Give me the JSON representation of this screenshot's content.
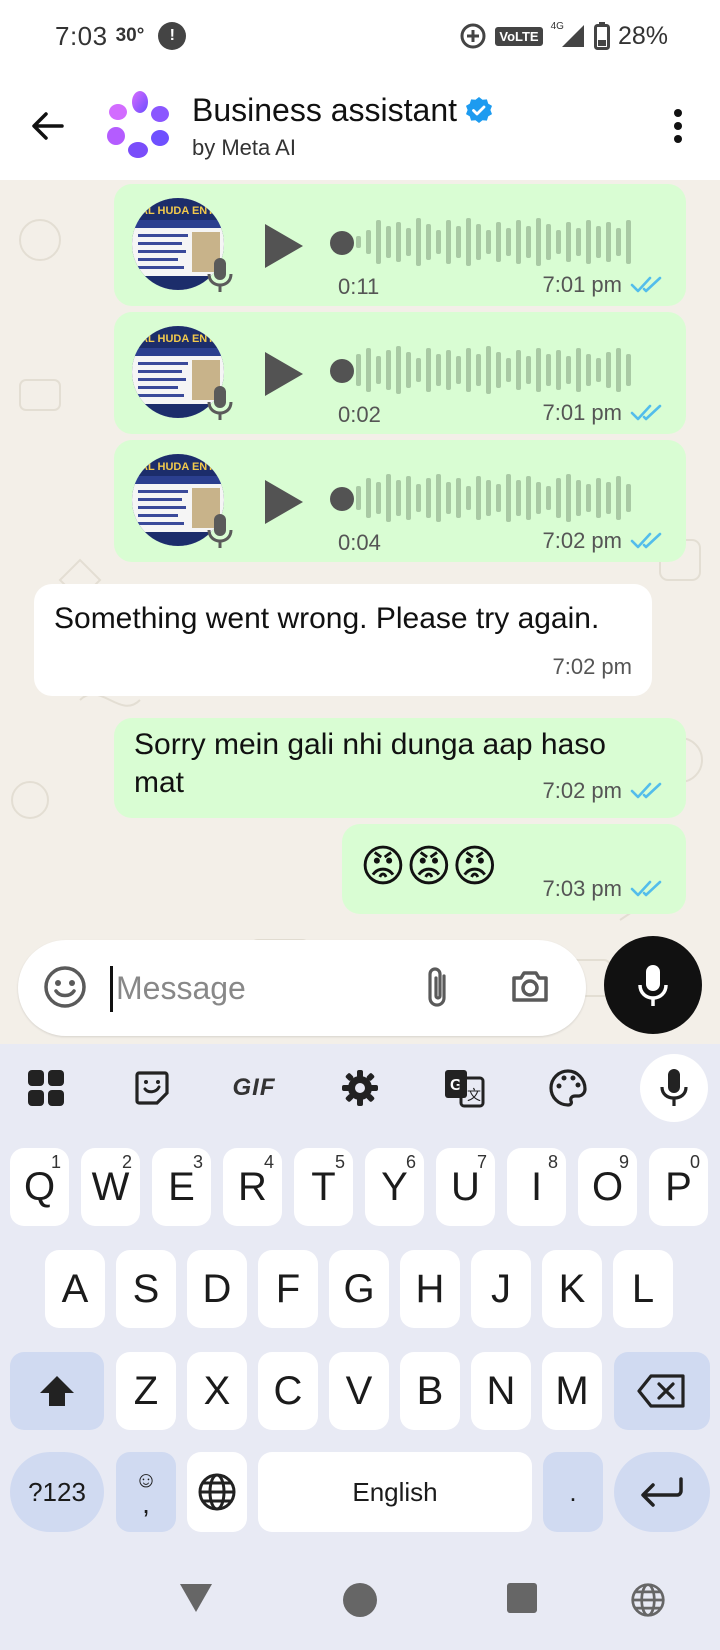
{
  "status_bar": {
    "time": "7:03",
    "temperature": "30°",
    "alert_icon": "!",
    "network": "4G",
    "volte": "VoLTE",
    "battery": "28%"
  },
  "header": {
    "title": "Business assistant",
    "subtitle": "by Meta AI",
    "verified_icon": "verified-badge-icon"
  },
  "messages": [
    {
      "type": "voice",
      "direction": "out",
      "duration": "0:11",
      "time": "7:01 pm",
      "status": "read"
    },
    {
      "type": "voice",
      "direction": "out",
      "duration": "0:02",
      "time": "7:01 pm",
      "status": "read"
    },
    {
      "type": "voice",
      "direction": "out",
      "duration": "0:04",
      "time": "7:02 pm",
      "status": "read"
    },
    {
      "type": "text",
      "direction": "in",
      "text": "Something went wrong. Please try again.",
      "time": "7:02 pm"
    },
    {
      "type": "text",
      "direction": "out",
      "text": "Sorry mein gali nhi dunga aap haso mat",
      "time": "7:02 pm",
      "status": "read"
    },
    {
      "type": "emoji",
      "direction": "out",
      "text": "😡😡😡",
      "time": "7:03 pm",
      "status": "read"
    }
  ],
  "voice_thumb": {
    "brand": "AL HUDA ENT",
    "line1": "Mehboob Nashimah Bijapur"
  },
  "composer": {
    "placeholder": "Message"
  },
  "keyboard": {
    "row1": [
      {
        "key": "Q",
        "hint": "1"
      },
      {
        "key": "W",
        "hint": "2"
      },
      {
        "key": "E",
        "hint": "3"
      },
      {
        "key": "R",
        "hint": "4"
      },
      {
        "key": "T",
        "hint": "5"
      },
      {
        "key": "Y",
        "hint": "6"
      },
      {
        "key": "U",
        "hint": "7"
      },
      {
        "key": "I",
        "hint": "8"
      },
      {
        "key": "O",
        "hint": "9"
      },
      {
        "key": "P",
        "hint": "0"
      }
    ],
    "row2": [
      "A",
      "S",
      "D",
      "F",
      "G",
      "H",
      "J",
      "K",
      "L"
    ],
    "row3": [
      "Z",
      "X",
      "C",
      "V",
      "B",
      "N",
      "M"
    ],
    "symbols_label": "?123",
    "emoji_key": "☺",
    "comma": ",",
    "space_label": "English",
    "period": ".",
    "gif_label": "GIF"
  },
  "colors": {
    "outgoing_bubble": "#d9fdd3",
    "incoming_bubble": "#ffffff",
    "read_ticks": "#53bdeb",
    "verified": "#1d9bf0"
  }
}
